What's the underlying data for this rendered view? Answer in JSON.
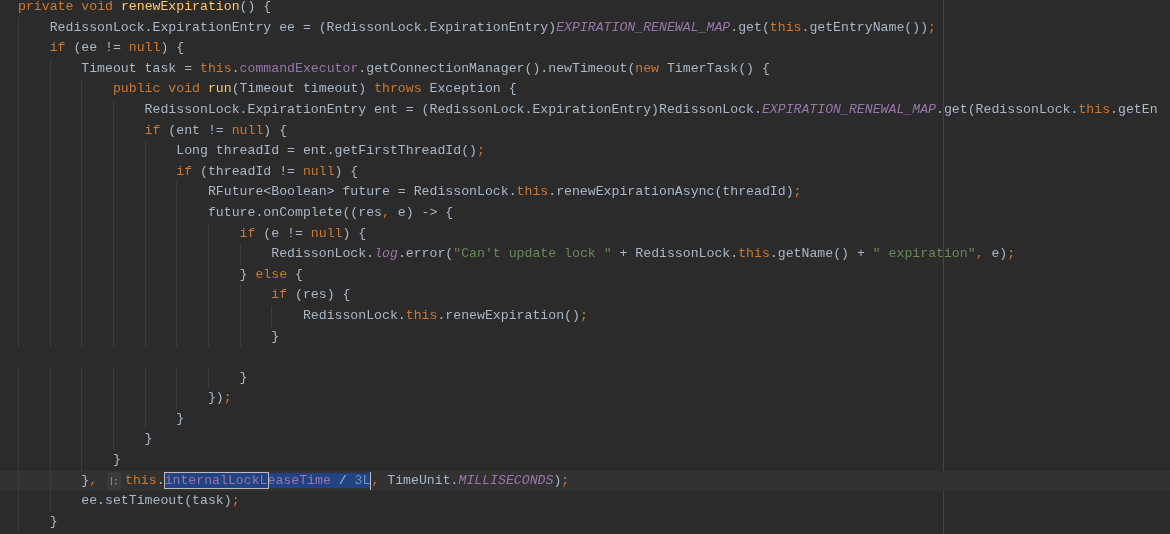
{
  "editor": {
    "lines": [
      {
        "current": false,
        "tokens": [
          {
            "kind": "keyword",
            "text": "private void "
          },
          {
            "kind": "method",
            "text": "renewExpiration"
          },
          {
            "kind": "plain",
            "text": "() {"
          }
        ]
      },
      {
        "current": false,
        "tokens": [
          {
            "kind": "plain",
            "text": "    RedissonLock.ExpirationEntry ee = (RedissonLock.ExpirationEntry)"
          },
          {
            "kind": "static",
            "text": "EXPIRATION_RENEWAL_MAP"
          },
          {
            "kind": "plain",
            "text": ".get("
          },
          {
            "kind": "keyword",
            "text": "this"
          },
          {
            "kind": "plain",
            "text": ".getEntryName())"
          },
          {
            "kind": "keyword",
            "text": ";"
          }
        ]
      },
      {
        "current": false,
        "tokens": [
          {
            "kind": "keyword",
            "text": "    if"
          },
          {
            "kind": "plain",
            "text": " (ee != "
          },
          {
            "kind": "keyword",
            "text": "null"
          },
          {
            "kind": "plain",
            "text": ") {"
          }
        ]
      },
      {
        "current": false,
        "tokens": [
          {
            "kind": "plain",
            "text": "        Timeout task = "
          },
          {
            "kind": "keyword",
            "text": "this"
          },
          {
            "kind": "plain",
            "text": "."
          },
          {
            "kind": "field",
            "text": "commandExecutor"
          },
          {
            "kind": "plain",
            "text": ".getConnectionManager().newTimeout("
          },
          {
            "kind": "keyword",
            "text": "new"
          },
          {
            "kind": "plain",
            "text": " TimerTask() {"
          }
        ]
      },
      {
        "current": false,
        "tokens": [
          {
            "kind": "keyword",
            "text": "            public void "
          },
          {
            "kind": "method",
            "text": "run"
          },
          {
            "kind": "plain",
            "text": "(Timeout timeout) "
          },
          {
            "kind": "keyword",
            "text": "throws"
          },
          {
            "kind": "plain",
            "text": " Exception {"
          }
        ]
      },
      {
        "current": false,
        "tokens": [
          {
            "kind": "plain",
            "text": "                RedissonLock.ExpirationEntry ent = (RedissonLock.ExpirationEntry)RedissonLock."
          },
          {
            "kind": "static",
            "text": "EXPIRATION_RENEWAL_MAP"
          },
          {
            "kind": "plain",
            "text": ".get(RedissonLock."
          },
          {
            "kind": "keyword",
            "text": "this"
          },
          {
            "kind": "plain",
            "text": ".getEn"
          }
        ]
      },
      {
        "current": false,
        "tokens": [
          {
            "kind": "keyword",
            "text": "                if"
          },
          {
            "kind": "plain",
            "text": " (ent != "
          },
          {
            "kind": "keyword",
            "text": "null"
          },
          {
            "kind": "plain",
            "text": ") {"
          }
        ]
      },
      {
        "current": false,
        "tokens": [
          {
            "kind": "plain",
            "text": "                    Long threadId = ent.getFirstThreadId()"
          },
          {
            "kind": "keyword",
            "text": ";"
          }
        ]
      },
      {
        "current": false,
        "tokens": [
          {
            "kind": "keyword",
            "text": "                    if"
          },
          {
            "kind": "plain",
            "text": " (threadId != "
          },
          {
            "kind": "keyword",
            "text": "null"
          },
          {
            "kind": "plain",
            "text": ") {"
          }
        ]
      },
      {
        "current": false,
        "tokens": [
          {
            "kind": "plain",
            "text": "                        RFuture<Boolean> future = RedissonLock."
          },
          {
            "kind": "keyword",
            "text": "this"
          },
          {
            "kind": "plain",
            "text": ".renewExpirationAsync(threadId)"
          },
          {
            "kind": "keyword",
            "text": ";"
          }
        ]
      },
      {
        "current": false,
        "tokens": [
          {
            "kind": "plain",
            "text": "                        future.onComplete((res"
          },
          {
            "kind": "keyword",
            "text": ","
          },
          {
            "kind": "plain",
            "text": " e) -> {"
          }
        ]
      },
      {
        "current": false,
        "tokens": [
          {
            "kind": "keyword",
            "text": "                            if"
          },
          {
            "kind": "plain",
            "text": " (e != "
          },
          {
            "kind": "keyword",
            "text": "null"
          },
          {
            "kind": "plain",
            "text": ") {"
          }
        ]
      },
      {
        "current": false,
        "tokens": [
          {
            "kind": "plain",
            "text": "                                RedissonLock."
          },
          {
            "kind": "static",
            "text": "log"
          },
          {
            "kind": "plain",
            "text": ".error("
          },
          {
            "kind": "string",
            "text": "\"Can't update lock \""
          },
          {
            "kind": "plain",
            "text": " + RedissonLock."
          },
          {
            "kind": "keyword",
            "text": "this"
          },
          {
            "kind": "plain",
            "text": ".getName() + "
          },
          {
            "kind": "string",
            "text": "\" expiration\""
          },
          {
            "kind": "keyword",
            "text": ","
          },
          {
            "kind": "plain",
            "text": " e)"
          },
          {
            "kind": "keyword",
            "text": ";"
          }
        ]
      },
      {
        "current": false,
        "tokens": [
          {
            "kind": "plain",
            "text": "                            } "
          },
          {
            "kind": "keyword",
            "text": "else"
          },
          {
            "kind": "plain",
            "text": " {"
          }
        ]
      },
      {
        "current": false,
        "tokens": [
          {
            "kind": "keyword",
            "text": "                                if"
          },
          {
            "kind": "plain",
            "text": " (res) {"
          }
        ]
      },
      {
        "current": false,
        "tokens": [
          {
            "kind": "plain",
            "text": "                                    RedissonLock."
          },
          {
            "kind": "keyword",
            "text": "this"
          },
          {
            "kind": "plain",
            "text": ".renewExpiration()"
          },
          {
            "kind": "keyword",
            "text": ";"
          }
        ]
      },
      {
        "current": false,
        "tokens": [
          {
            "kind": "plain",
            "text": "                                }"
          }
        ]
      },
      {
        "current": false
      },
      {
        "current": false,
        "tokens": [
          {
            "kind": "plain",
            "text": "                            }"
          }
        ]
      },
      {
        "current": false,
        "tokens": [
          {
            "kind": "plain",
            "text": "                        })"
          },
          {
            "kind": "keyword",
            "text": ";"
          }
        ]
      },
      {
        "current": false,
        "tokens": [
          {
            "kind": "plain",
            "text": "                    }"
          }
        ]
      },
      {
        "current": false,
        "tokens": [
          {
            "kind": "plain",
            "text": "                }"
          }
        ]
      },
      {
        "current": false,
        "tokens": [
          {
            "kind": "plain",
            "text": "            }"
          }
        ]
      },
      {
        "current": true,
        "tokens": [
          {
            "kind": "plain",
            "text": "        }"
          },
          {
            "kind": "keyword",
            "text": ", "
          },
          {
            "kind": "hint"
          },
          {
            "kind": "keyword",
            "text": "this"
          },
          {
            "kind": "plain",
            "text": "."
          },
          {
            "kind": "selection",
            "children": [
              {
                "kind": "match",
                "children": [
                  {
                    "kind": "field",
                    "text": "internalLockL"
                  }
                ]
              },
              {
                "kind": "field",
                "text": "easeTime"
              },
              {
                "kind": "plain",
                "text": " / "
              },
              {
                "kind": "number",
                "text": "3L"
              }
            ]
          },
          {
            "kind": "caret"
          },
          {
            "kind": "keyword",
            "text": ","
          },
          {
            "kind": "plain",
            "text": " TimeUnit."
          },
          {
            "kind": "static",
            "text": "MILLISECONDS"
          },
          {
            "kind": "plain",
            "text": ")"
          },
          {
            "kind": "keyword",
            "text": ";"
          }
        ]
      },
      {
        "current": false,
        "tokens": [
          {
            "kind": "plain",
            "text": "        ee.setTimeout(task)"
          },
          {
            "kind": "keyword",
            "text": ";"
          }
        ]
      },
      {
        "current": false,
        "tokens": [
          {
            "kind": "plain",
            "text": "    }"
          }
        ]
      }
    ]
  }
}
